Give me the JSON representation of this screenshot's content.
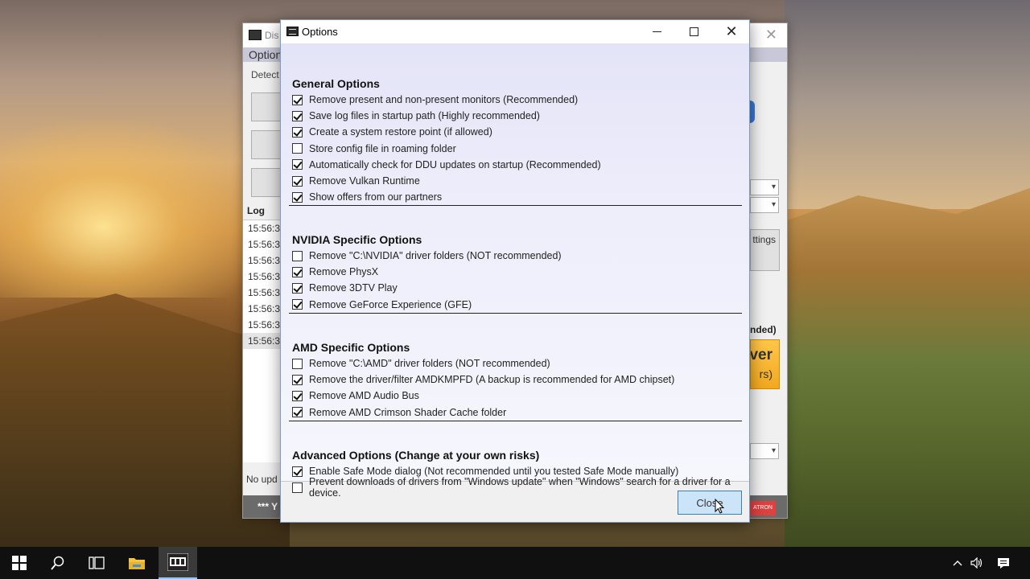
{
  "background_window": {
    "title": "Dis",
    "menu": "Option",
    "detect_label": "Detect",
    "log_label": "Log",
    "log_lines": [
      "15:56:3",
      "15:56:3",
      "15:56:3",
      "15:56:3",
      "15:56:3",
      "15:56:3",
      "15:56:3",
      "15:56:3"
    ],
    "status": "No upd",
    "bottom_banner": "*** Y",
    "settings_btn": "ttings",
    "nded_label": "nded)",
    "orange_big": "ver",
    "orange_small": "rs)",
    "atron": "ATRON"
  },
  "dialog": {
    "title": "Options",
    "sections": [
      {
        "title": "General Options",
        "options": [
          {
            "label": "Remove present and non-present monitors (Recommended)",
            "checked": true
          },
          {
            "label": "Save log files in startup path (Highly recommended)",
            "checked": true
          },
          {
            "label": "Create a system restore point (if allowed)",
            "checked": true
          },
          {
            "label": "Store config file in roaming folder",
            "checked": false
          },
          {
            "label": "Automatically check for DDU updates on startup (Recommended)",
            "checked": true
          },
          {
            "label": "Remove Vulkan Runtime",
            "checked": true
          },
          {
            "label": "Show offers from our partners",
            "checked": true
          }
        ]
      },
      {
        "title": "NVIDIA Specific Options",
        "options": [
          {
            "label": "Remove \"C:\\NVIDIA\" driver folders (NOT recommended)",
            "checked": false
          },
          {
            "label": "Remove PhysX",
            "checked": true
          },
          {
            "label": "Remove 3DTV Play",
            "checked": true
          },
          {
            "label": "Remove GeForce Experience (GFE)",
            "checked": true
          }
        ]
      },
      {
        "title": "AMD Specific Options",
        "options": [
          {
            "label": "Remove \"C:\\AMD\" driver folders (NOT recommended)",
            "checked": false
          },
          {
            "label": "Remove the driver/filter AMDKMPFD (A backup is recommended for AMD chipset)",
            "checked": true
          },
          {
            "label": "Remove AMD Audio Bus",
            "checked": true
          },
          {
            "label": "Remove AMD Crimson Shader Cache folder",
            "checked": true
          }
        ]
      },
      {
        "title": "Advanced Options (Change at your own risks)",
        "options": [
          {
            "label": "Enable Safe Mode dialog (Not recommended until you tested Safe Mode manually)",
            "checked": true
          },
          {
            "label": "Prevent downloads of drivers from \"Windows update\" when \"Windows\" search for a driver for a device.",
            "checked": false
          }
        ]
      }
    ],
    "close_label": "Close"
  },
  "taskbar": {
    "items": [
      "windows-start-icon",
      "search-icon",
      "task-view-icon",
      "file-explorer-icon",
      "ddu-app-icon"
    ],
    "tray": [
      "chevron-up-icon",
      "volume-icon",
      "notifications-icon"
    ]
  }
}
